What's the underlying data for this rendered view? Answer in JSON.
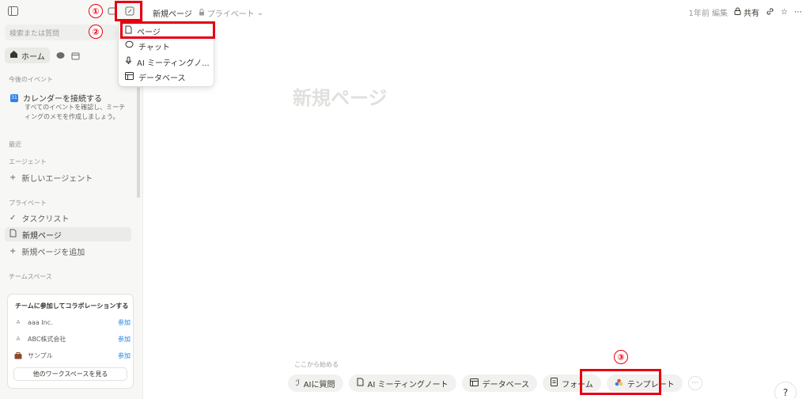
{
  "sidebar": {
    "search_placeholder": "検索または質問",
    "home_tab": "ホーム",
    "events_label": "今後のイベント",
    "calendar": {
      "title": "カレンダーを接続する",
      "desc": "すべてのイベントを確認し、ミーティングのメモを作成しましょう。",
      "badge": "31"
    },
    "recent_label": "最近",
    "agents_label": "エージェント",
    "new_agent": "新しいエージェント",
    "private_label": "プライベート",
    "private_items": [
      "タスクリスト",
      "新規ページ",
      "新規ページを追加"
    ],
    "teamspace_label": "チームスペース",
    "team_card": {
      "title": "チームに参加してコラボレーションする",
      "workspaces": [
        {
          "icon": "A",
          "name": "aaa Inc.",
          "action": "参加"
        },
        {
          "icon": "A",
          "name": "ABC株式会社",
          "action": "参加"
        },
        {
          "icon": "briefcase-icon",
          "name": "サンプル",
          "action": "参加"
        }
      ],
      "button": "他のワークスペースを見る"
    }
  },
  "header": {
    "page_name": "新規ページ",
    "privacy": "プライベート",
    "edited": "1年前 編集",
    "share": "共有"
  },
  "dropdown": {
    "items": [
      "ページ",
      "チャット",
      "AI ミーティングノ...",
      "データベース"
    ]
  },
  "main": {
    "title": "新規ページ",
    "start_hint": "ここから始める",
    "chips": [
      "AIに質問",
      "AI ミーティングノート",
      "データベース",
      "フォーム",
      "テンプレート"
    ]
  },
  "annotations": {
    "step1": "①",
    "step2": "②",
    "step3": "③",
    "color": "#e60012"
  },
  "help_icon": "?"
}
